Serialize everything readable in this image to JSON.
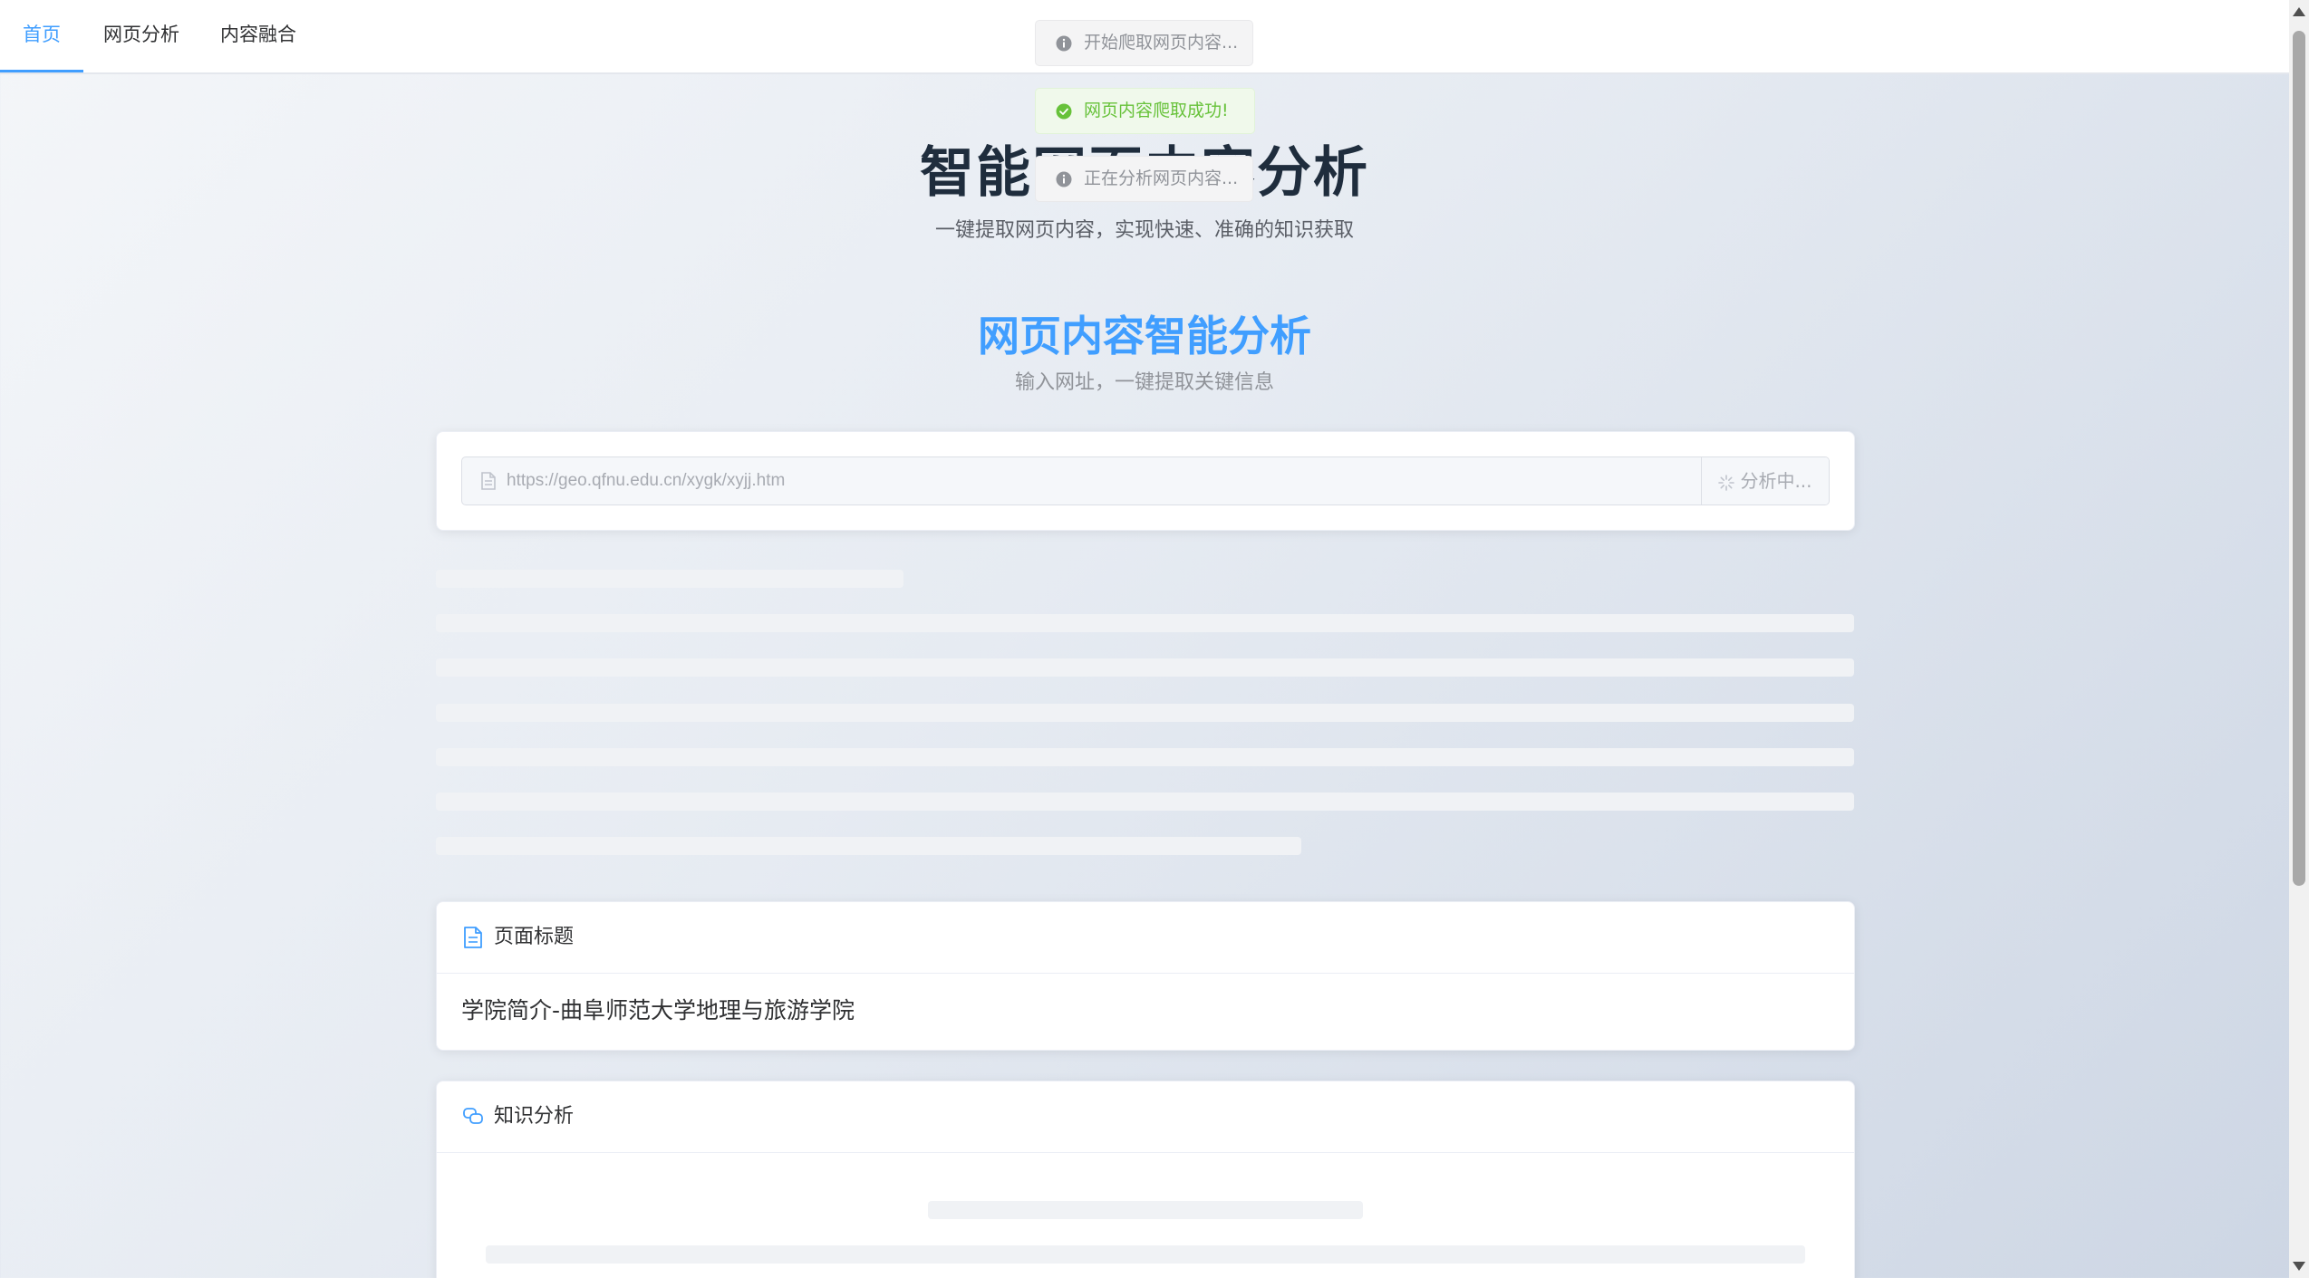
{
  "nav": {
    "tabs": [
      {
        "label": "首页",
        "active": true
      },
      {
        "label": "网页分析",
        "active": false
      },
      {
        "label": "内容融合",
        "active": false
      }
    ]
  },
  "hero": {
    "title": "智能网页内容分析",
    "subtitle": "一键提取网页内容，实现快速、准确的知识获取"
  },
  "section": {
    "title": "网页内容智能分析",
    "subtitle": "输入网址，一键提取关键信息"
  },
  "search": {
    "url_value": "https://geo.qfnu.edu.cn/xygk/xyjj.htm",
    "button_label": "分析中..."
  },
  "title_card": {
    "header": "页面标题",
    "content": "学院简介-曲阜师范大学地理与旅游学院"
  },
  "knowledge_card": {
    "header": "知识分析"
  },
  "toasts": [
    {
      "type": "info",
      "text": "开始爬取网页内容..."
    },
    {
      "type": "success",
      "text": "网页内容爬取成功!"
    },
    {
      "type": "info",
      "text": "正在分析网页内容..."
    }
  ],
  "colors": {
    "accent": "#409eff",
    "success": "#67c23a",
    "info": "#909399",
    "heading": "#1f2d3d"
  },
  "icons": {
    "url_input": "document-icon",
    "analyze_button": "loading-spinner-icon",
    "title_card": "document-icon",
    "knowledge_card": "chat-bubbles-icon",
    "toast_info": "info-circle-icon",
    "toast_success": "check-circle-icon"
  }
}
